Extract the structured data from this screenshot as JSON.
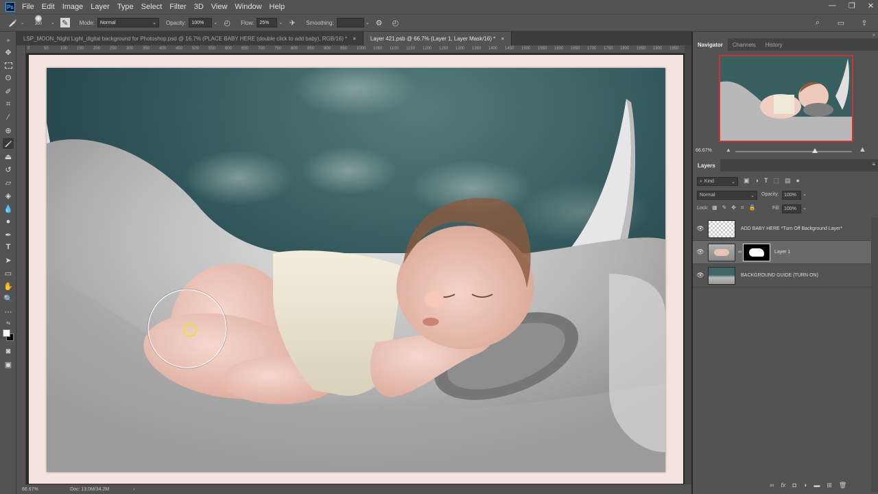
{
  "menubar": {
    "items": [
      "File",
      "Edit",
      "Image",
      "Layer",
      "Type",
      "Select",
      "Filter",
      "3D",
      "View",
      "Window",
      "Help"
    ]
  },
  "options": {
    "brush_size": "300",
    "mode_label": "Mode:",
    "mode_value": "Normal",
    "opacity_label": "Opacity:",
    "opacity_value": "100%",
    "flow_label": "Flow:",
    "flow_value": "25%",
    "smoothing_label": "Smoothing:"
  },
  "tabs": [
    {
      "label": "LSP_MOON_Night Light_digital background for Photoshop.psd @ 16.7% (PLACE BABY HERE (double click to add baby), RGB/16) *",
      "close": "×"
    },
    {
      "label": "Layer 421.psb @ 66.7% (Layer 1, Layer Mask/16) *",
      "close": "×"
    }
  ],
  "ruler_ticks": [
    "0",
    "50",
    "100",
    "150",
    "200",
    "250",
    "300",
    "350",
    "400",
    "450",
    "500",
    "550",
    "600",
    "650",
    "700",
    "750",
    "800",
    "850",
    "900",
    "950",
    "1000",
    "1050",
    "1100",
    "1150",
    "1200",
    "1250",
    "1300",
    "1350",
    "1400",
    "1450",
    "1500",
    "1550",
    "1600",
    "1650",
    "1700",
    "1750",
    "1800",
    "1850",
    "1900",
    "1950"
  ],
  "status": {
    "zoom": "66.67%",
    "doc": "Doc: 13.0M/34.2M",
    "arrow": "›"
  },
  "navigator": {
    "tabs": [
      "Navigator",
      "Channels",
      "History"
    ],
    "zoom": "66.67%",
    "zoom_level": 0.68
  },
  "layers_panel": {
    "title": "Layers",
    "kind_label": "Kind",
    "blend_mode": "Normal",
    "opacity_label": "Opacity:",
    "opacity_value": "100%",
    "lock_label": "Lock:",
    "fill_label": "Fill:",
    "fill_value": "100%",
    "layers": [
      {
        "name": "ADD BABY HERE *Turn Off Background Layer*"
      },
      {
        "name": "Layer 1"
      },
      {
        "name": "BACKGROUND GUIDE (TURN ON)"
      }
    ]
  },
  "colors": {
    "accent_red": "#d03030",
    "panel_bg": "#535353",
    "selected_layer": "#696969"
  }
}
